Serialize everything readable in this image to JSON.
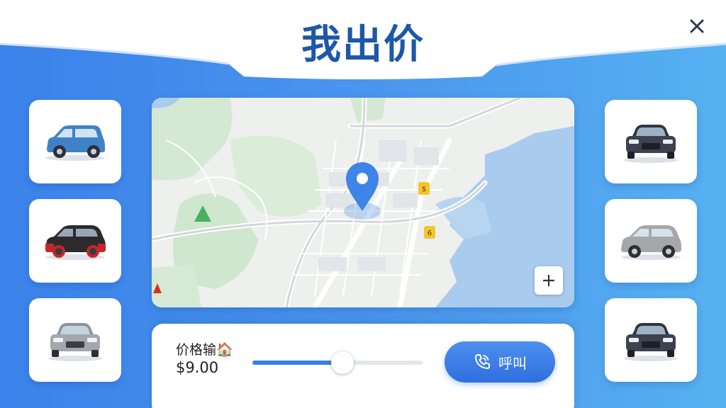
{
  "header": {
    "title": "我出价"
  },
  "price": {
    "label": "价格输🏠",
    "value": "$9.00",
    "slider_fraction": 0.53
  },
  "call_button": {
    "label": "呼叫"
  },
  "left_cars": [
    {
      "icon": "blue-hatchback-icon",
      "color": "#3f82c7"
    },
    {
      "icon": "black-red-hatchback-icon",
      "color": "#2b2b2e"
    },
    {
      "icon": "silver-sedan-front-icon",
      "color": "#a4a7ab"
    }
  ],
  "right_cars": [
    {
      "icon": "dark-sedan-front-icon",
      "color": "#3c4250"
    },
    {
      "icon": "silver-hatchback-icon",
      "color": "#a5a7aa"
    },
    {
      "icon": "dark-sedan-front-icon",
      "color": "#3c4250"
    }
  ],
  "colors": {
    "accent": "#2f6fde",
    "title": "#1d58a8",
    "water": "#a9cbee",
    "park": "#cfe6cf"
  }
}
